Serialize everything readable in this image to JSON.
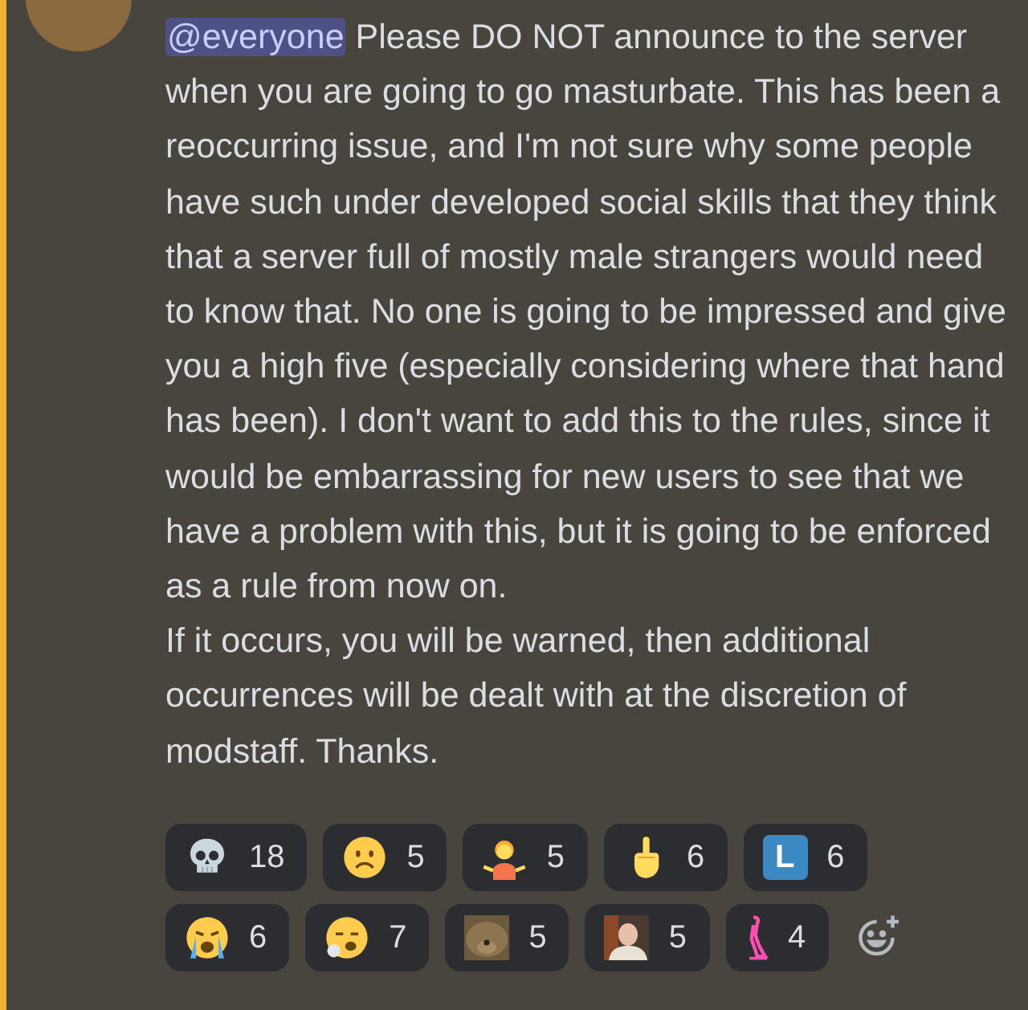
{
  "message": {
    "mention": "@everyone",
    "paragraphs": [
      "Please DO NOT announce to the server when you are going to go masturbate. This has been a reoccurring issue, and I'm not sure why some people have such under developed social skills that they think that a server full of mostly male strangers would need to know that. No one is going to be impressed and give you a high five (especially considering where that hand has been). I don't want to add this to the rules, since it would be embarrassing for new users to see that we have a problem with this, but it is going to be enforced as a rule from now on.",
      "If it occurs, you will be warned, then additional occurrences will be dealt with at the discretion of modstaff. Thanks."
    ]
  },
  "reactions": [
    {
      "kind": "icon",
      "count": "18"
    },
    {
      "kind": "icon",
      "count": "5"
    },
    {
      "kind": "icon",
      "count": "5"
    },
    {
      "kind": "icon",
      "count": "6"
    },
    {
      "kind": "letter",
      "glyph": "L",
      "count": "6"
    },
    {
      "kind": "icon",
      "count": "6"
    },
    {
      "kind": "icon",
      "count": "7"
    },
    {
      "kind": "picture",
      "count": "5"
    },
    {
      "kind": "picture",
      "count": "5"
    },
    {
      "kind": "icon",
      "count": "4"
    }
  ]
}
